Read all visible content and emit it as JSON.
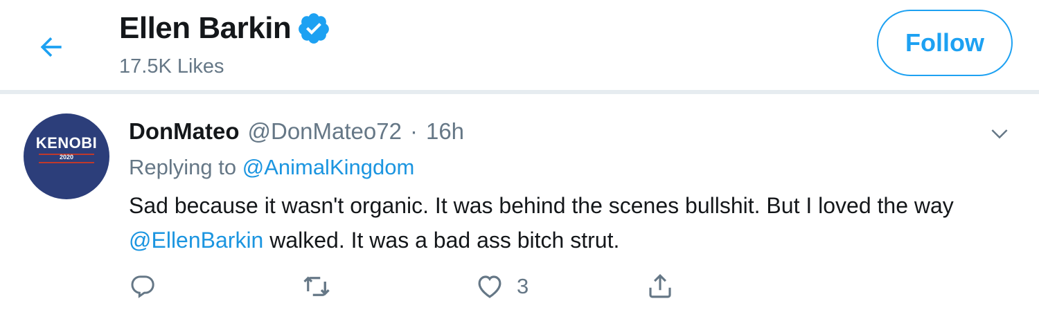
{
  "header": {
    "back_icon": "back-arrow-icon",
    "profile_name": "Ellen Barkin",
    "verified_icon": "verified-badge-icon",
    "likes_count": "17.5K Likes",
    "follow_label": "Follow"
  },
  "tweet": {
    "avatar": {
      "line1": "KENOBI",
      "line2": "2020"
    },
    "display_name": "DonMateo",
    "handle": "@DonMateo72",
    "separator": "·",
    "time": "16h",
    "caret_icon": "chevron-down-icon",
    "replying_to_label": "Replying to",
    "replying_to_handle": "@AnimalKingdom",
    "text_part1": "Sad because it wasn't organic. It was behind the scenes bullshit. But I loved the way",
    "text_mention": "@EllenBarkin",
    "text_part2": "walked. It was a bad ass bitch strut.",
    "actions": {
      "reply_icon": "reply-icon",
      "retweet_icon": "retweet-icon",
      "like_icon": "heart-icon",
      "like_count": "3",
      "share_icon": "share-icon"
    }
  },
  "colors": {
    "accent": "#1da1f2",
    "link": "#1b95e0",
    "muted": "#657786",
    "text": "#14171a",
    "divider": "#e6ecf0"
  }
}
